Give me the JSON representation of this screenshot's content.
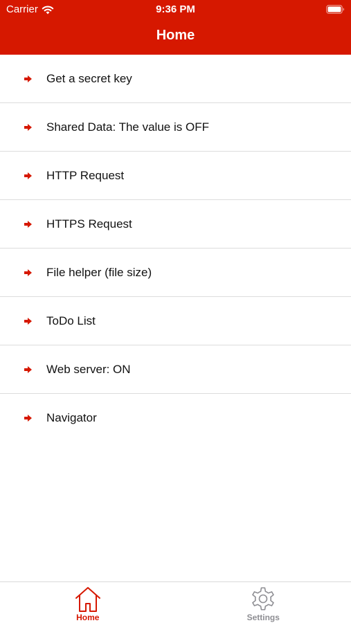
{
  "status_bar": {
    "carrier": "Carrier",
    "time": "9:36 PM"
  },
  "nav": {
    "title": "Home"
  },
  "colors": {
    "accent": "#d61800",
    "inactive": "#8e8e93"
  },
  "list": {
    "items": [
      {
        "label": "Get a secret key",
        "icon": "arrow-right-icon"
      },
      {
        "label": "Shared Data: The value is OFF",
        "icon": "arrow-right-icon"
      },
      {
        "label": "HTTP Request",
        "icon": "arrow-right-icon"
      },
      {
        "label": "HTTPS Request",
        "icon": "arrow-right-icon"
      },
      {
        "label": "File helper (file size)",
        "icon": "arrow-right-icon"
      },
      {
        "label": "ToDo List",
        "icon": "arrow-right-icon"
      },
      {
        "label": "Web server: ON",
        "icon": "arrow-right-icon"
      },
      {
        "label": "Navigator",
        "icon": "arrow-right-icon"
      }
    ]
  },
  "tabbar": {
    "tabs": [
      {
        "label": "Home",
        "icon": "home-icon",
        "selected": true
      },
      {
        "label": "Settings",
        "icon": "gear-icon",
        "selected": false
      }
    ]
  }
}
